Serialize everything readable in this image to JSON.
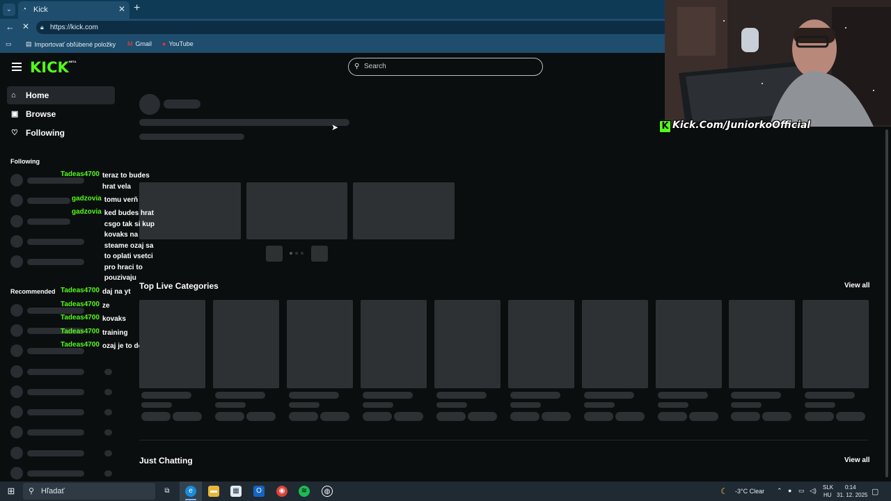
{
  "browser": {
    "tab_title": "Kick",
    "url": "https://kick.com",
    "bookmarks": [
      {
        "label": "Importovať obľúbené položky",
        "icon": "folder-icon"
      },
      {
        "label": "Gmail",
        "icon": "gmail-icon"
      },
      {
        "label": "YouTube",
        "icon": "youtube-icon"
      }
    ]
  },
  "kick": {
    "logo_text": "KICK",
    "beta_label": "BETA",
    "search_placeholder": "Search",
    "nav": [
      {
        "label": "Home",
        "icon": "home-icon"
      },
      {
        "label": "Browse",
        "icon": "browse-icon"
      },
      {
        "label": "Following",
        "icon": "heart-icon"
      }
    ],
    "following_label": "Following",
    "recommended_label": "Recommended",
    "top_live_categories": "Top Live Categories",
    "just_chatting": "Just Chatting",
    "view_all_1": "View all",
    "view_all_2": "View all"
  },
  "chat": [
    {
      "user": "Tadeas4700",
      "msg": "teraz to budes hrat vela"
    },
    {
      "user": "gadzovia",
      "msg": "tomu verň"
    },
    {
      "user": "gadzovia",
      "msg": "ked budes hrat csgo tak si kup kovaks na steame ozaj sa to oplati vsetci pro hraci to pouzivaju"
    },
    {
      "user": "Tadeas4700",
      "msg": "daj na yt"
    },
    {
      "user": "Tadeas4700",
      "msg": "ze"
    },
    {
      "user": "Tadeas4700",
      "msg": "kovaks"
    },
    {
      "user": "Tadeas4700",
      "msg": "training"
    },
    {
      "user": "Tadeas4700",
      "msg": "ozaj je to dohre"
    }
  ],
  "webcam_overlay": "Kick.Com/JuniorkoOfficial",
  "taskbar": {
    "search_label": "Hľadať",
    "weather": "-3°C  Clear",
    "language_top": "SLK",
    "language_bottom": "HU",
    "time": "0:14",
    "date": "31. 12. 2025"
  }
}
